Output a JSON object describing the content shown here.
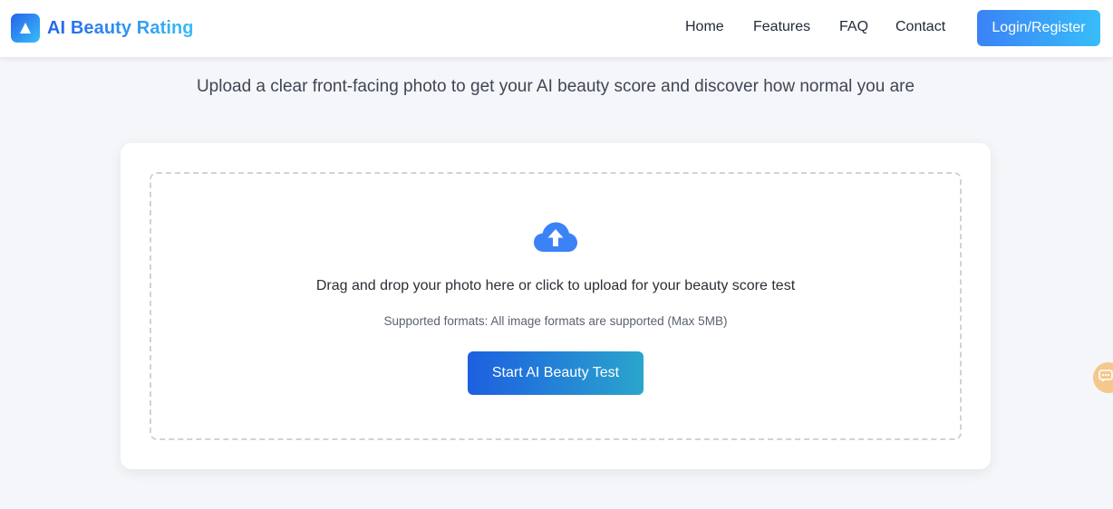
{
  "brand": {
    "name": "AI Beauty Rating",
    "logo_icon": "triangle-logo-icon"
  },
  "nav": {
    "items": [
      {
        "label": "Home"
      },
      {
        "label": "Features"
      },
      {
        "label": "FAQ"
      },
      {
        "label": "Contact"
      }
    ],
    "login_label": "Login/Register"
  },
  "main": {
    "subtitle": "Upload a clear front-facing photo to get your AI beauty score and discover how normal you are",
    "upload": {
      "icon": "cloud-upload-icon",
      "instruction": "Drag and drop your photo here or click to upload for your beauty score test",
      "formats": "Supported formats: All image formats are supported (Max 5MB)",
      "button_label": "Start AI Beauty Test"
    }
  },
  "chat_widget": {
    "icon": "chat-icon"
  },
  "colors": {
    "accent": "#2563eb",
    "accent_light": "#38bdf8",
    "background": "#f4f6f9",
    "chat": "#f4c78d"
  }
}
